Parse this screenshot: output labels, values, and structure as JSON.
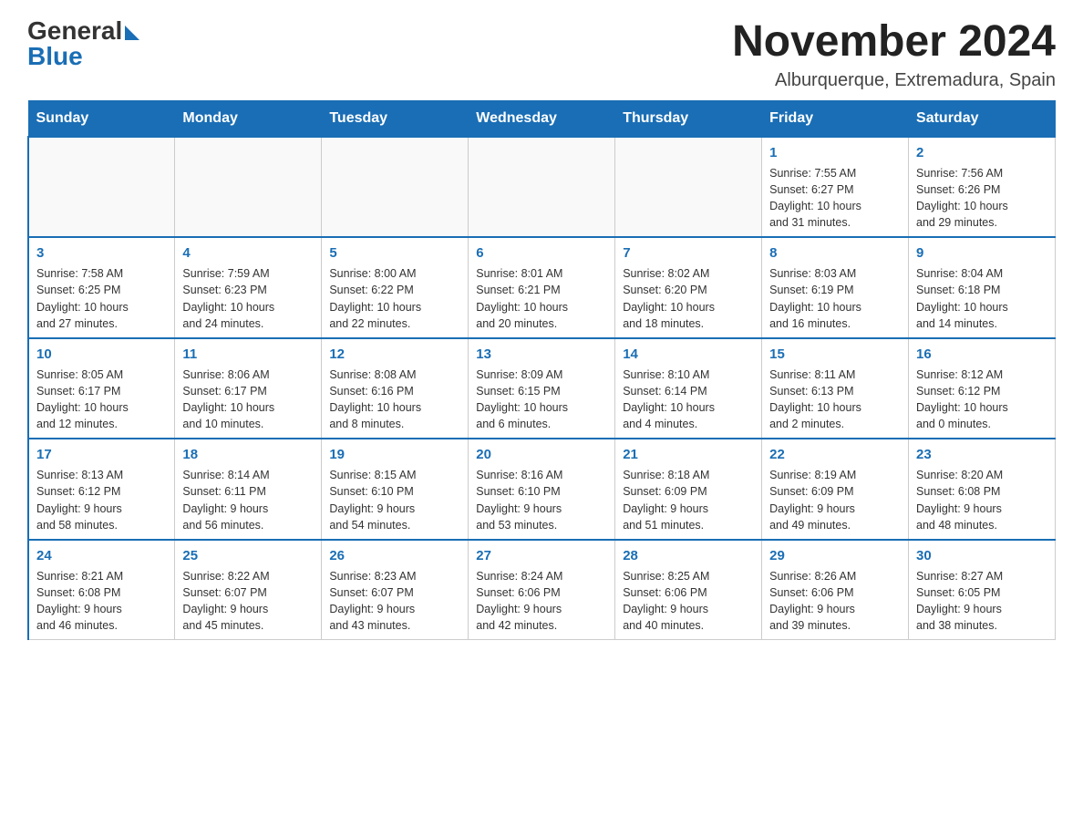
{
  "logo": {
    "general": "General",
    "blue": "Blue"
  },
  "header": {
    "title": "November 2024",
    "subtitle": "Alburquerque, Extremadura, Spain"
  },
  "weekdays": [
    "Sunday",
    "Monday",
    "Tuesday",
    "Wednesday",
    "Thursday",
    "Friday",
    "Saturday"
  ],
  "weeks": [
    [
      {
        "day": "",
        "info": ""
      },
      {
        "day": "",
        "info": ""
      },
      {
        "day": "",
        "info": ""
      },
      {
        "day": "",
        "info": ""
      },
      {
        "day": "",
        "info": ""
      },
      {
        "day": "1",
        "info": "Sunrise: 7:55 AM\nSunset: 6:27 PM\nDaylight: 10 hours\nand 31 minutes."
      },
      {
        "day": "2",
        "info": "Sunrise: 7:56 AM\nSunset: 6:26 PM\nDaylight: 10 hours\nand 29 minutes."
      }
    ],
    [
      {
        "day": "3",
        "info": "Sunrise: 7:58 AM\nSunset: 6:25 PM\nDaylight: 10 hours\nand 27 minutes."
      },
      {
        "day": "4",
        "info": "Sunrise: 7:59 AM\nSunset: 6:23 PM\nDaylight: 10 hours\nand 24 minutes."
      },
      {
        "day": "5",
        "info": "Sunrise: 8:00 AM\nSunset: 6:22 PM\nDaylight: 10 hours\nand 22 minutes."
      },
      {
        "day": "6",
        "info": "Sunrise: 8:01 AM\nSunset: 6:21 PM\nDaylight: 10 hours\nand 20 minutes."
      },
      {
        "day": "7",
        "info": "Sunrise: 8:02 AM\nSunset: 6:20 PM\nDaylight: 10 hours\nand 18 minutes."
      },
      {
        "day": "8",
        "info": "Sunrise: 8:03 AM\nSunset: 6:19 PM\nDaylight: 10 hours\nand 16 minutes."
      },
      {
        "day": "9",
        "info": "Sunrise: 8:04 AM\nSunset: 6:18 PM\nDaylight: 10 hours\nand 14 minutes."
      }
    ],
    [
      {
        "day": "10",
        "info": "Sunrise: 8:05 AM\nSunset: 6:17 PM\nDaylight: 10 hours\nand 12 minutes."
      },
      {
        "day": "11",
        "info": "Sunrise: 8:06 AM\nSunset: 6:17 PM\nDaylight: 10 hours\nand 10 minutes."
      },
      {
        "day": "12",
        "info": "Sunrise: 8:08 AM\nSunset: 6:16 PM\nDaylight: 10 hours\nand 8 minutes."
      },
      {
        "day": "13",
        "info": "Sunrise: 8:09 AM\nSunset: 6:15 PM\nDaylight: 10 hours\nand 6 minutes."
      },
      {
        "day": "14",
        "info": "Sunrise: 8:10 AM\nSunset: 6:14 PM\nDaylight: 10 hours\nand 4 minutes."
      },
      {
        "day": "15",
        "info": "Sunrise: 8:11 AM\nSunset: 6:13 PM\nDaylight: 10 hours\nand 2 minutes."
      },
      {
        "day": "16",
        "info": "Sunrise: 8:12 AM\nSunset: 6:12 PM\nDaylight: 10 hours\nand 0 minutes."
      }
    ],
    [
      {
        "day": "17",
        "info": "Sunrise: 8:13 AM\nSunset: 6:12 PM\nDaylight: 9 hours\nand 58 minutes."
      },
      {
        "day": "18",
        "info": "Sunrise: 8:14 AM\nSunset: 6:11 PM\nDaylight: 9 hours\nand 56 minutes."
      },
      {
        "day": "19",
        "info": "Sunrise: 8:15 AM\nSunset: 6:10 PM\nDaylight: 9 hours\nand 54 minutes."
      },
      {
        "day": "20",
        "info": "Sunrise: 8:16 AM\nSunset: 6:10 PM\nDaylight: 9 hours\nand 53 minutes."
      },
      {
        "day": "21",
        "info": "Sunrise: 8:18 AM\nSunset: 6:09 PM\nDaylight: 9 hours\nand 51 minutes."
      },
      {
        "day": "22",
        "info": "Sunrise: 8:19 AM\nSunset: 6:09 PM\nDaylight: 9 hours\nand 49 minutes."
      },
      {
        "day": "23",
        "info": "Sunrise: 8:20 AM\nSunset: 6:08 PM\nDaylight: 9 hours\nand 48 minutes."
      }
    ],
    [
      {
        "day": "24",
        "info": "Sunrise: 8:21 AM\nSunset: 6:08 PM\nDaylight: 9 hours\nand 46 minutes."
      },
      {
        "day": "25",
        "info": "Sunrise: 8:22 AM\nSunset: 6:07 PM\nDaylight: 9 hours\nand 45 minutes."
      },
      {
        "day": "26",
        "info": "Sunrise: 8:23 AM\nSunset: 6:07 PM\nDaylight: 9 hours\nand 43 minutes."
      },
      {
        "day": "27",
        "info": "Sunrise: 8:24 AM\nSunset: 6:06 PM\nDaylight: 9 hours\nand 42 minutes."
      },
      {
        "day": "28",
        "info": "Sunrise: 8:25 AM\nSunset: 6:06 PM\nDaylight: 9 hours\nand 40 minutes."
      },
      {
        "day": "29",
        "info": "Sunrise: 8:26 AM\nSunset: 6:06 PM\nDaylight: 9 hours\nand 39 minutes."
      },
      {
        "day": "30",
        "info": "Sunrise: 8:27 AM\nSunset: 6:05 PM\nDaylight: 9 hours\nand 38 minutes."
      }
    ]
  ]
}
